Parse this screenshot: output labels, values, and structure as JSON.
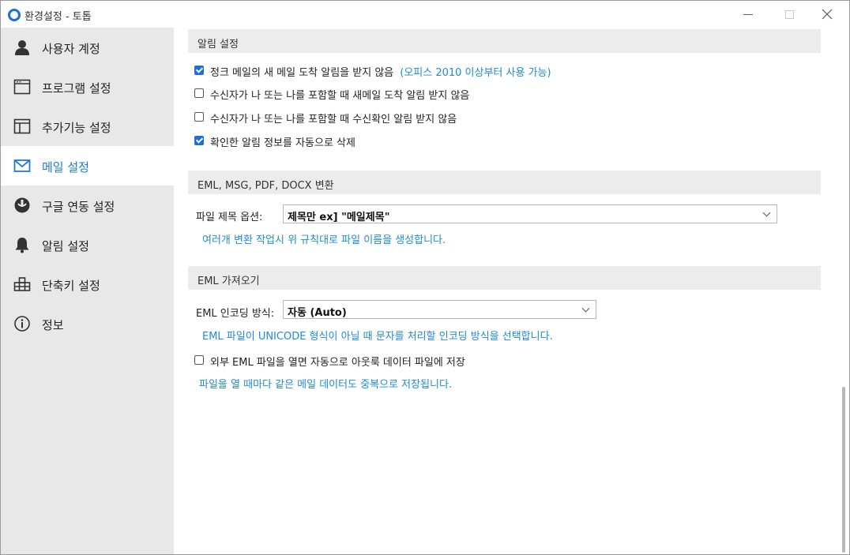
{
  "window": {
    "title": "환경설정 - 토톱",
    "accent_color": "#1e6fd9",
    "link_color": "#1e8ad6"
  },
  "sidebar": {
    "items": [
      {
        "label": "사용자 계정",
        "icon": "person-icon"
      },
      {
        "label": "프로그램 설정",
        "icon": "window-icon"
      },
      {
        "label": "추가기능 설정",
        "icon": "panel-icon"
      },
      {
        "label": "메일 설정",
        "icon": "envelope-icon",
        "active": true
      },
      {
        "label": "구글 연동 설정",
        "icon": "google-icon"
      },
      {
        "label": "알림 설정",
        "icon": "bell-icon"
      },
      {
        "label": "단축키 설정",
        "icon": "keyboard-icon"
      },
      {
        "label": "정보",
        "icon": "info-icon"
      }
    ]
  },
  "notifications": {
    "title": "알림 설정",
    "options": [
      {
        "label": "정크 메일의 새 메일 도착 알림을 받지 않음",
        "note": "(오피스 2010 이상부터 사용 가능)",
        "checked": true
      },
      {
        "label": "수신자가 나 또는 나를 포함할 때 새메일 도착 알림 받지 않음",
        "checked": false
      },
      {
        "label": "수신자가 나 또는 나를 포함할 때 수신확인 알림 받지 않음",
        "checked": false
      },
      {
        "label": "확인한 알림 정보를 자동으로 삭제",
        "checked": true
      }
    ]
  },
  "conversion": {
    "title": "EML, MSG, PDF, DOCX 변환",
    "field_label": "파일 제목 옵션:",
    "selected": "제목만 ex] \"메일제목\"",
    "hint": "여러개 변환 작업시 위 규칙대로 파일 이름을 생성합니다."
  },
  "eml_import": {
    "title": "EML 가져오기",
    "field_label": "EML 인코딩 방식:",
    "selected": "자동 (Auto)",
    "hint": "EML 파일이 UNICODE 형식이 아닐 때 문자를 처리할 인코딩 방식을 선택합니다.",
    "auto_save": {
      "label": "외부 EML 파일을 열면 자동으로 아웃룩 데이터 파일에 저장",
      "checked": false
    },
    "auto_save_hint": "파일을 열 때마다 같은 메일 데이터도 중복으로 저장됩니다."
  }
}
